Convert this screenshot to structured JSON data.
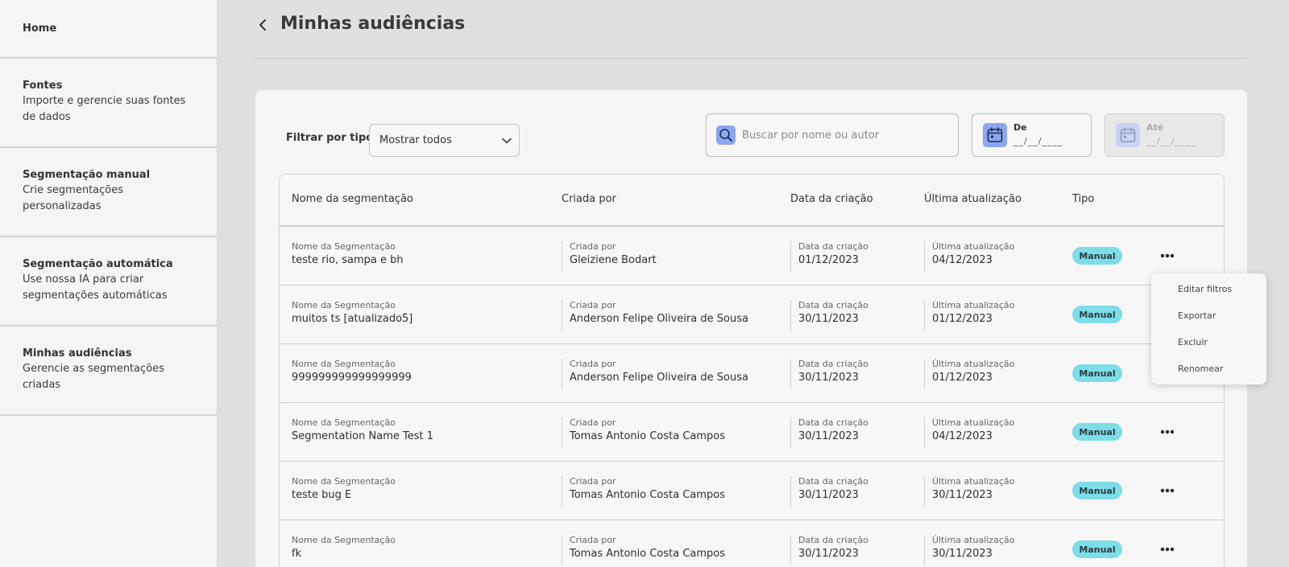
{
  "sidebar": {
    "items": [
      {
        "title": "Home"
      },
      {
        "title": "Fontes",
        "description": "Importe e gerencie suas fontes de dados"
      },
      {
        "title": "Segmentação manual",
        "description": "Crie segmentações personalizadas"
      },
      {
        "title": "Segmentação automática",
        "description": "Use nossa IA para criar segmentações automáticas"
      },
      {
        "title": "Minhas audiências",
        "description": "Gerencie as segmentações criadas"
      }
    ]
  },
  "header": {
    "title": "Minhas audiências"
  },
  "filters": {
    "type_label": "Filtrar por tipo:",
    "type_value": "Mostrar todos",
    "search_placeholder": "Buscar por nome ou autor",
    "from_label": "De",
    "from_value": "__/__/____",
    "to_label": "Até",
    "to_value": "__/__/____"
  },
  "table": {
    "headers": [
      "Nome da segmentação",
      "Criada por",
      "Data da criação",
      "Última atualização",
      "Tipo"
    ],
    "cell_labels": {
      "name": "Nome da Segmentação",
      "author": "Criada por",
      "created": "Data da criação",
      "updated": "Última atualização"
    },
    "rows": [
      {
        "name": "teste rio, sampa e bh",
        "author": "Gleiziene Bodart",
        "created": "01/12/2023",
        "updated": "04/12/2023",
        "type": "Manual"
      },
      {
        "name": "muitos ts [atualizado5]",
        "author": "Anderson Felipe Oliveira de Sousa",
        "created": "30/11/2023",
        "updated": "01/12/2023",
        "type": "Manual"
      },
      {
        "name": "999999999999999999",
        "author": "Anderson Felipe Oliveira de Sousa",
        "created": "30/11/2023",
        "updated": "01/12/2023",
        "type": "Manual"
      },
      {
        "name": "Segmentation Name Test 1",
        "author": "Tomas Antonio Costa Campos",
        "created": "30/11/2023",
        "updated": "04/12/2023",
        "type": "Manual"
      },
      {
        "name": "teste bug E",
        "author": "Tomas Antonio Costa Campos",
        "created": "30/11/2023",
        "updated": "30/11/2023",
        "type": "Manual"
      },
      {
        "name": "fk",
        "author": "Tomas Antonio Costa Campos",
        "created": "30/11/2023",
        "updated": "30/11/2023",
        "type": "Manual"
      }
    ]
  },
  "context_menu": {
    "items": [
      "Editar filtros",
      "Exportar",
      "Excluir",
      "Renomear"
    ]
  }
}
